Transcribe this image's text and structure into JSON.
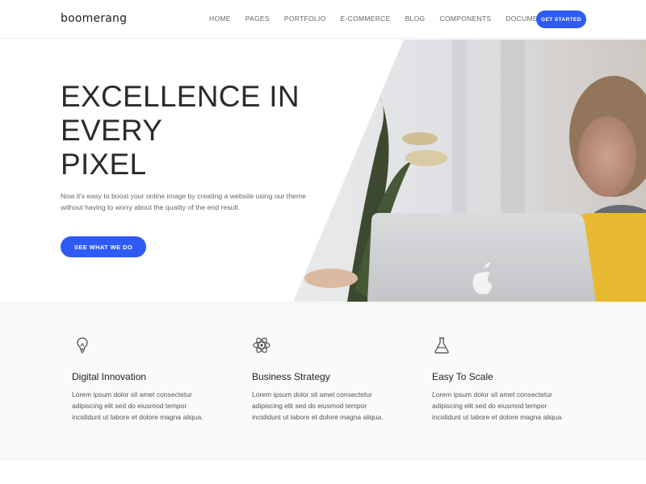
{
  "header": {
    "logo": "boomerang",
    "nav": [
      "HOME",
      "PAGES",
      "PORTFOLIO",
      "E-COMMERCE",
      "BLOG",
      "COMPONENTS",
      "DOCUMENTATION"
    ],
    "cta": "GET STARTED",
    "accent": "#2f5bf5"
  },
  "hero": {
    "title_lines": [
      "EXCELLENCE IN",
      "EVERY",
      "PIXEL"
    ],
    "text": "Now it's easy to boost your online image by creating a website using our theme without having to worry about the quality of the end result.",
    "cta": "SEE WHAT WE DO",
    "image": "woman-with-laptop-photo"
  },
  "features": [
    {
      "icon": "lightbulb-icon",
      "title": "Digital Innovation",
      "text": "Lorem ipsum dolor sit amet consectetur adipiscing elit sed do eiusmod tempor incididunt ut labore et dolore magna aliqua."
    },
    {
      "icon": "atom-icon",
      "title": "Business Strategy",
      "text": "Lorem ipsum dolor sit amet consectetur adipiscing elit sed do eiusmod tempor incididunt ut labore et dolore magna aliqua."
    },
    {
      "icon": "flask-icon",
      "title": "Easy To Scale",
      "text": "Lorem ipsum dolor sit amet consectetur adipiscing elit sed do eiusmod tempor incididunt ut labore et dolore magna aliqua."
    }
  ]
}
